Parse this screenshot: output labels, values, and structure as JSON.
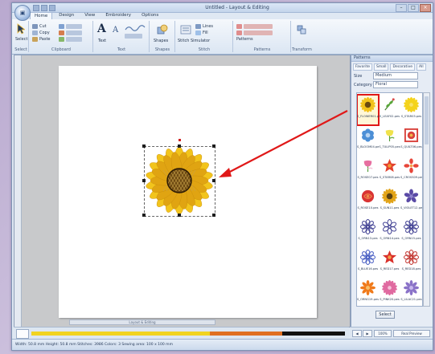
{
  "window": {
    "title": "Untitled - Layout & Editing",
    "tabs": [
      "Home",
      "Design",
      "View",
      "Embroidery",
      "Options"
    ],
    "active_tab": "Home"
  },
  "ribbon": {
    "groups": [
      "Select",
      "Clipboard",
      "Text",
      "Shapes",
      "Stitch",
      "Patterns",
      "Transform"
    ],
    "buttons": {
      "select": "Select",
      "cut": "Cut",
      "copy": "Copy",
      "paste": "Paste",
      "text_label": "Text",
      "lines": "Lines",
      "shapes": "Shapes",
      "fill": "Fill",
      "stitch": "Stitch Simulator",
      "patterns": "Patterns"
    }
  },
  "panel": {
    "title": "Patterns",
    "tabs": [
      "Favorite",
      "Small",
      "Decorative",
      "All"
    ],
    "size_label": "Size",
    "size_value": "Medium",
    "category_label": "Category",
    "category_value": "Floral",
    "select_button": "Select",
    "items": [
      {
        "caption": "S_FLOWER01.pes",
        "color": "#f2c21a",
        "center": "#6b4a10",
        "kind": "sunflower",
        "selected": true
      },
      {
        "caption": "S_LEAF02.pes",
        "color": "#5aa63a",
        "center": "#d94a4a",
        "kind": "sprig"
      },
      {
        "caption": "S_STAR03.pes",
        "color": "#f4d31c",
        "center": "#f7e26b",
        "kind": "burst"
      },
      {
        "caption": "S_BLOOM04.pes",
        "color": "#4c8fd6",
        "center": "#b7d3f1",
        "kind": "circle"
      },
      {
        "caption": "S_TULIP05.pes",
        "color": "#f0e24b",
        "center": "#6fb04a",
        "kind": "tulip"
      },
      {
        "caption": "S_QUILT06.pes",
        "color": "#d9423c",
        "center": "#f0b54a",
        "kind": "square"
      },
      {
        "caption": "S_ROSE07.pes",
        "color": "#e76fa0",
        "center": "#f6c2d8",
        "kind": "tulip"
      },
      {
        "caption": "S_STAR08.pes",
        "color": "#e2402c",
        "center": "#f39a33",
        "kind": "star"
      },
      {
        "caption": "S_CROSS09.pes",
        "color": "#e7463a",
        "center": "#f5a24a",
        "kind": "cross"
      },
      {
        "caption": "S_ROSE10.pes",
        "color": "#d93434",
        "center": "#f08a4a",
        "kind": "rose"
      },
      {
        "caption": "S_SUN11.pes",
        "color": "#e2a419",
        "center": "#5b4212",
        "kind": "sunflower"
      },
      {
        "caption": "S_VIOLET12.pes",
        "color": "#5a4aa6",
        "center": "#8f83cf",
        "kind": "violet"
      },
      {
        "caption": "S_ORN13.pes",
        "color": "#3a3a8f",
        "center": "#ffffff",
        "kind": "outline"
      },
      {
        "caption": "S_ORN14.pes",
        "color": "#3a3a8f",
        "center": "#ffffff",
        "kind": "outline2"
      },
      {
        "caption": "S_ORN15.pes",
        "color": "#3a3a8f",
        "center": "#ffffff",
        "kind": "outline"
      },
      {
        "caption": "S_BLUE16.pes",
        "color": "#3f56c0",
        "center": "#8ea0e8",
        "kind": "outline"
      },
      {
        "caption": "S_RED17.pes",
        "color": "#d9302a",
        "center": "#f2a04a",
        "kind": "star"
      },
      {
        "caption": "S_RED18.pes",
        "color": "#c0302a",
        "center": "#ffffff",
        "kind": "outline"
      },
      {
        "caption": "S_ORNG19.pes",
        "color": "#f07a1a",
        "center": "#f7c06a",
        "kind": "fan"
      },
      {
        "caption": "S_PINK20.pes",
        "color": "#e06aa0",
        "center": "#f5c0d8",
        "kind": "burst"
      },
      {
        "caption": "S_LILAC21.pes",
        "color": "#8a72c8",
        "center": "#c8b8ee",
        "kind": "fan"
      }
    ]
  },
  "canvas": {
    "design_name": "sunflower",
    "petal_color": "#f2c41c",
    "petal_shade": "#e0a412",
    "center_color": "#6e4a12",
    "accent": "#e01818"
  },
  "workspace_scroll_label": "Layout & Editing",
  "color_sequence": [
    {
      "color": "#f1d321",
      "fraction": 0.57
    },
    {
      "color": "#e06f22",
      "fraction": 0.23
    },
    {
      "color": "#111111",
      "fraction": 0.2
    }
  ],
  "bottom_tools": [
    "◀",
    "▶",
    "100%",
    "Real Preview"
  ],
  "status_text": "Width: 50.8 mm  Height: 50.8 mm  Stitches: 3986  Colors: 3   Sewing area: 100 x 100 mm"
}
